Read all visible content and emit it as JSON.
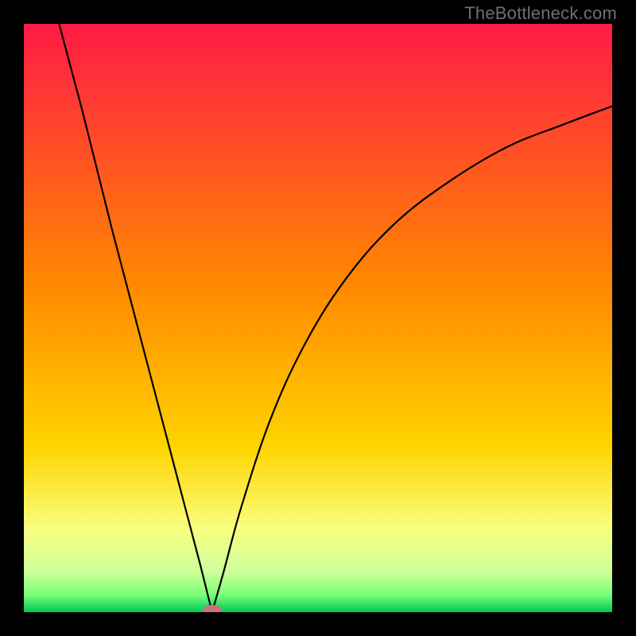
{
  "watermark": "TheBottleneck.com",
  "chart_data": {
    "type": "line",
    "title": "",
    "xlabel": "",
    "ylabel": "",
    "xlim": [
      0,
      100
    ],
    "ylim": [
      0,
      100
    ],
    "background_gradient": {
      "top": "#FF1A46",
      "mid": "#FFD400",
      "bottom_band_top": "#F8FF80",
      "bottom_band_mid": "#7CFF7A",
      "bottom": "#00C853"
    },
    "curve_color": "#000000",
    "curve": {
      "min_x": 32,
      "left": [
        {
          "x": 6,
          "y": 100
        },
        {
          "x": 10,
          "y": 85
        },
        {
          "x": 15,
          "y": 65
        },
        {
          "x": 20,
          "y": 46
        },
        {
          "x": 25,
          "y": 27
        },
        {
          "x": 30,
          "y": 8
        },
        {
          "x": 32,
          "y": 0
        }
      ],
      "right": [
        {
          "x": 32,
          "y": 0
        },
        {
          "x": 34,
          "y": 7
        },
        {
          "x": 37,
          "y": 18
        },
        {
          "x": 42,
          "y": 33
        },
        {
          "x": 48,
          "y": 46
        },
        {
          "x": 55,
          "y": 57
        },
        {
          "x": 63,
          "y": 66
        },
        {
          "x": 72,
          "y": 73
        },
        {
          "x": 82,
          "y": 79
        },
        {
          "x": 92,
          "y": 83
        },
        {
          "x": 100,
          "y": 86
        }
      ]
    },
    "marker": {
      "x": 32,
      "y": 0,
      "rx": 12,
      "ry": 6,
      "fill": "#C9727F"
    }
  }
}
